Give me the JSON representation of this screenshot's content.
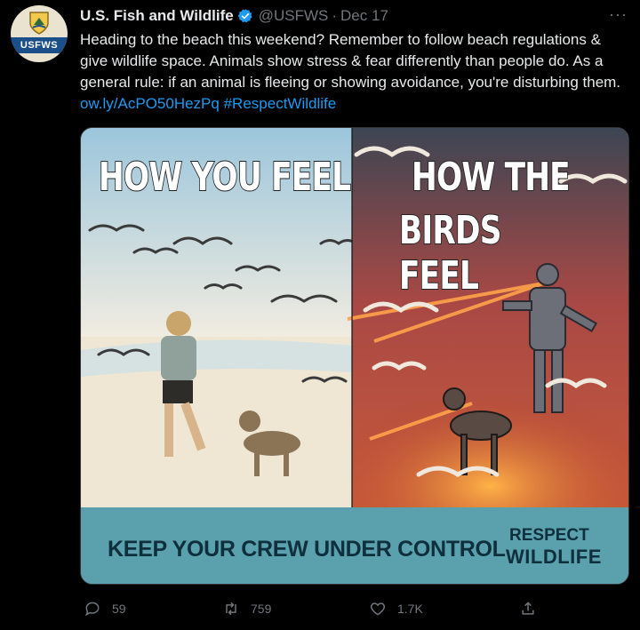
{
  "account": {
    "name": "U.S. Fish and Wildlife",
    "handle": "@USFWS",
    "separator": "·",
    "date": "Dec 17",
    "avatar_label": "USFWS"
  },
  "tweet": {
    "text": "Heading to the beach this weekend? Remember to follow beach regulations & give wildlife space. Animals show stress & fear differently than people do. As a general rule: if an animal is fleeing or showing avoidance, you're disturbing them.",
    "link": "ow.ly/AcPO50HezPq",
    "hashtag": "#RespectWildlife"
  },
  "image": {
    "left_title": "HOW YOU FEEL",
    "right_title_line1": "HOW THE",
    "right_title_line2": "BIRDS FEEL",
    "footer": "KEEP YOUR CREW UNDER CONTROL",
    "brand_line1": "RESPECT",
    "brand_line2": "WILDLIFE"
  },
  "actions": {
    "reply_count": "59",
    "retweet_count": "759",
    "like_count": "1.7K"
  },
  "colors": {
    "link": "#1d9bf0",
    "muted": "#71767b",
    "footer_bg": "#5aa0ad"
  },
  "icons": [
    "verified-badge-icon",
    "more-icon",
    "reply-icon",
    "retweet-icon",
    "like-icon",
    "share-icon"
  ]
}
